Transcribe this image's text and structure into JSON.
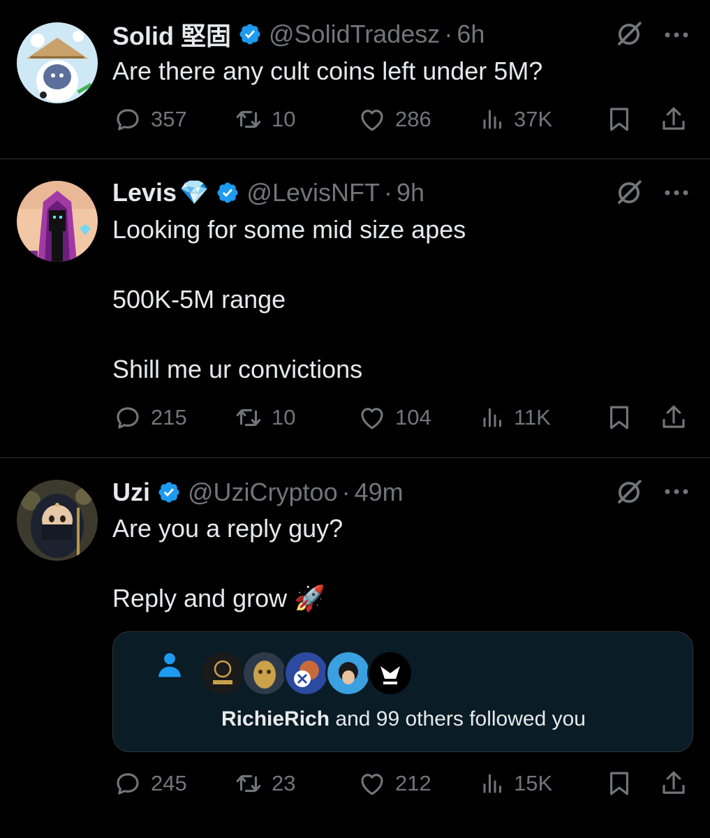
{
  "tweets": [
    {
      "name": "Solid 堅固",
      "handle": "@SolidTradesz",
      "time": "6h",
      "text": "Are there any cult coins left under 5M?",
      "stats": {
        "replies": "357",
        "reposts": "10",
        "likes": "286",
        "views": "37K"
      }
    },
    {
      "name": "Levis",
      "name_emoji": "💎",
      "handle": "@LevisNFT",
      "time": "9h",
      "text": "Looking for some mid size apes\n\n500K-5M range\n\nShill me ur convictions",
      "stats": {
        "replies": "215",
        "reposts": "10",
        "likes": "104",
        "views": "11K"
      }
    },
    {
      "name": "Uzi",
      "handle": "@UziCryptoo",
      "time": "49m",
      "text": "Are you a reply guy?\n\nReply and grow 🚀",
      "card": {
        "bold": "RichieRich",
        "rest": " and 99 others followed you"
      },
      "stats": {
        "replies": "245",
        "reposts": "23",
        "likes": "212",
        "views": "15K"
      }
    }
  ],
  "separator": "·",
  "colors": {
    "background": "#000000",
    "text": "#e7e9ea",
    "muted": "#71767b",
    "verified": "#1d9bf0",
    "card_bg": "#0a1c26"
  },
  "icons": [
    "verified-badge-icon",
    "grok-icon",
    "more-icon",
    "reply-icon",
    "repost-icon",
    "like-icon",
    "views-icon",
    "bookmark-icon",
    "share-icon",
    "person-icon"
  ]
}
